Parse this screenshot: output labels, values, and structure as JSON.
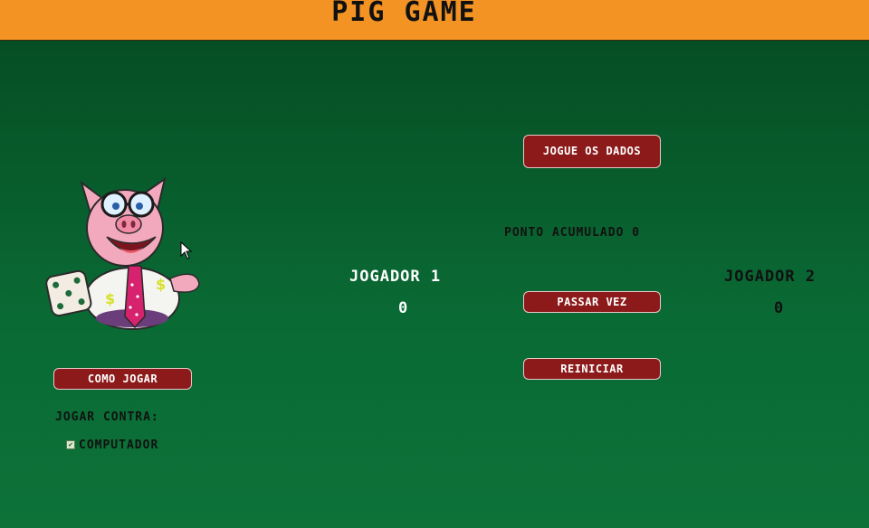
{
  "header": {
    "title": "PIG GAME",
    "bg_color": "#f39323"
  },
  "actions": {
    "roll_label": "JOGUE OS DADOS",
    "pass_label": "PASSAR VEZ",
    "reset_label": "REINICIAR",
    "how_to_label": "COMO JOGAR",
    "button_color": "#8c1a1a"
  },
  "status": {
    "accumulated_label": "PONTO ACUMULADO",
    "accumulated_value": "0"
  },
  "players": {
    "p1": {
      "name": "JOGADOR 1",
      "score": "0",
      "color": "#ffffff"
    },
    "p2": {
      "name": "JOGADOR 2",
      "score": "0",
      "color": "#111111"
    }
  },
  "options": {
    "play_against_label": "JOGAR CONTRA:",
    "computer_label": "COMPUTADOR",
    "computer_checked": true
  },
  "icons": {
    "mascot": "pig-mascot-icon",
    "cursor": "mouse-cursor-icon",
    "check": "checkmark-icon"
  }
}
